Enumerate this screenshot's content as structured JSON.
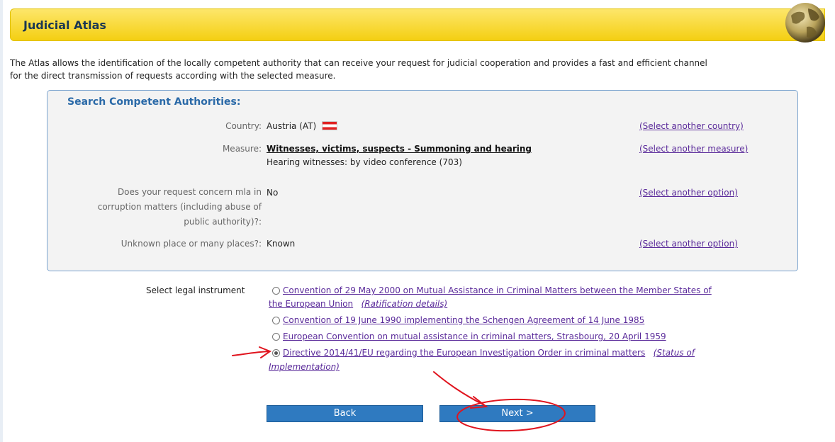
{
  "header": {
    "title": "Judicial Atlas"
  },
  "intro": {
    "line1": "The Atlas allows the identification of the locally competent authority that can receive your request for judicial cooperation and provides a fast and efficient channel",
    "line2": "for the direct transmission of requests according with the selected measure."
  },
  "search": {
    "title": "Search Competent Authorities:",
    "country_label": "Country:",
    "country_value": "Austria (AT)",
    "country_link": "(Select another country)",
    "measure_label": "Measure:",
    "measure_value": "Witnesses, victims, suspects - Summoning and hearing",
    "measure_sub": "Hearing witnesses: by video conference (703)",
    "measure_link": "(Select another measure)",
    "mla_label_1": "Does your request concern mla in",
    "mla_label_2": "corruption matters (including abuse of",
    "mla_label_3": "public authority)?:",
    "mla_value": "No",
    "mla_link": "(Select another option)",
    "place_label": "Unknown place or many places?:",
    "place_value": "Known",
    "place_link": "(Select another option)"
  },
  "legal": {
    "label": "Select legal instrument",
    "options": [
      {
        "text_1": "Convention of 29 May 2000 on Mutual Assistance in Criminal Matters between the Member States of",
        "text_2": "the European Union",
        "extra": "(Ratification details)",
        "checked": false
      },
      {
        "text_1": "Convention of 19 June 1990 implementing the Schengen Agreement of 14 June 1985",
        "checked": false
      },
      {
        "text_1": "European Convention on mutual assistance in criminal matters, Strasbourg, 20 April 1959",
        "checked": false
      },
      {
        "text_1": "Directive 2014/41/EU regarding the European Investigation Order in criminal matters",
        "extra_1": "(Status of",
        "extra_2": "Implementation)",
        "checked": true
      }
    ]
  },
  "buttons": {
    "back": "Back",
    "next": "Next >"
  },
  "colors": {
    "header_bg": "#f4cf12",
    "title_color": "#1b3752",
    "link_color": "#5a2a9a",
    "button_bg": "#2f7ac0",
    "annotation": "#e0141e"
  }
}
